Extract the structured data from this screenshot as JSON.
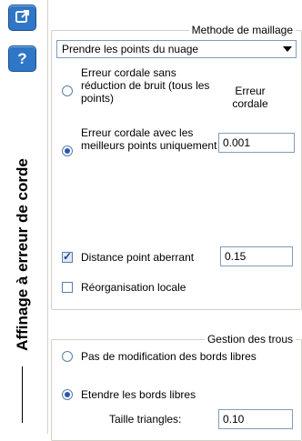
{
  "sidebar": {
    "vertical_title": "Affinage à erreur de corde",
    "buttons": [
      {
        "icon": "external-link-icon"
      },
      {
        "icon": "help-icon",
        "glyph": "?"
      }
    ]
  },
  "meshing": {
    "group_title": "Methode de maillage",
    "method_select_value": "Prendre les points du nuage",
    "options": [
      {
        "label": "Erreur cordale sans réduction de bruit (tous les points)",
        "checked": false
      },
      {
        "label": "Erreur cordale avec les meilleurs points uniquement",
        "checked": true
      }
    ],
    "error_label": "Erreur cordale",
    "error_value": "0.001",
    "outlier_checkbox_label": "Distance point aberrant",
    "outlier_checked": true,
    "outlier_value": "0.15",
    "reorg_checkbox_label": "Réorganisation locale",
    "reorg_checked": false
  },
  "holes": {
    "group_title": "Gestion des trous",
    "option_no_change": "Pas de modification des bords libres",
    "option_extend": "Etendre les bords libres",
    "selected": "extend",
    "triangle_size_label": "Taille triangles:",
    "triangle_size_value": "0.10"
  },
  "colors": {
    "accent": "#2f77c6",
    "group_border": "#d4d0c8",
    "input_border": "#7f9db9"
  }
}
